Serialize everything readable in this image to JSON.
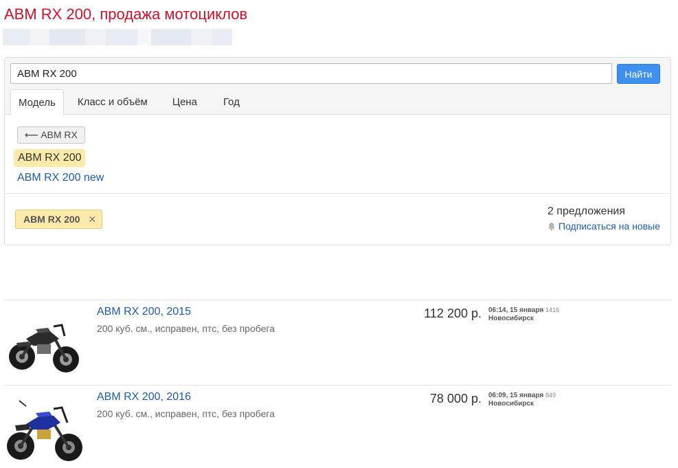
{
  "page": {
    "title": "ABM RX 200, продажа мотоциклов"
  },
  "search": {
    "query": "ABM RX 200",
    "button_label": "Найти"
  },
  "tabs": [
    {
      "label": "Модель",
      "active": true
    },
    {
      "label": "Класс и объём",
      "active": false
    },
    {
      "label": "Цена",
      "active": false
    },
    {
      "label": "Год",
      "active": false
    }
  ],
  "model_panel": {
    "back_label": "⟵ ABM RX",
    "selected_model": "ABM RX 200",
    "other_models": [
      "ABM RX 200 new"
    ]
  },
  "filters": {
    "chip_label": "ABM RX 200",
    "chip_remove_icon": "close-icon",
    "offers_count": "2 предложения",
    "subscribe_label": "Подписаться на новые"
  },
  "listings": [
    {
      "title": "ABM RX 200, 2015",
      "description": "200 куб. см., исправен, птс, без пробега",
      "price": "112 200 р.",
      "time": "06:14, 15 января",
      "views": "1416",
      "city": "Новосибирск",
      "image_icon": "motorcycle-black-icon"
    },
    {
      "title": "ABM RX 200, 2016",
      "description": "200 куб. см., исправен, птс, без пробега",
      "price": "78 000 р.",
      "time": "06:09, 15 января",
      "views": "849",
      "city": "Новосибирск",
      "image_icon": "motorcycle-blue-icon"
    }
  ],
  "colors": {
    "title_red": "#d0102a",
    "link_blue": "#1d5bb0",
    "button_blue": "#3d8ff0",
    "highlight_yellow": "#fbeaa9"
  }
}
